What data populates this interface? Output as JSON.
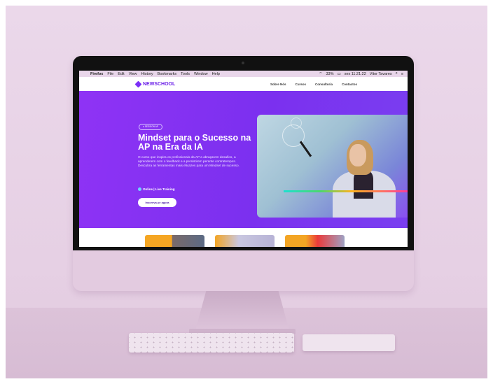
{
  "menubar": {
    "apple": "",
    "items": [
      "Firefox",
      "File",
      "Edit",
      "View",
      "History",
      "Bookmarks",
      "Tools",
      "Window",
      "Help"
    ],
    "battery": "33%",
    "clock": "sex 11:21:22",
    "user": "Vitor Tavares"
  },
  "site": {
    "logo": "NEWSCHOOL",
    "nav": [
      "Sobre Nós",
      "Cursos",
      "Consultoria",
      "Contactos"
    ]
  },
  "hero": {
    "badge": "● SESSION AP",
    "title": "Mindset para o Sucesso na AP na Era da IA",
    "description": "O curso que inspira os profissionais da AP a abraçarem desafios, a aprenderem com o feedback e a persistirem perante contratempos. Descubra as ferramentas mais eficazes para um Mindset de sucesso.",
    "mode": "Online | Live Training",
    "cta": "Inscreva-se agora"
  },
  "colors": {
    "brand": "#7b2ff7",
    "hero_bg": "#8433f2",
    "scene_bg": "#e6d0e4"
  },
  "icons": {
    "apple_chin": "apple-logo",
    "menubar_apple": "apple-icon"
  }
}
